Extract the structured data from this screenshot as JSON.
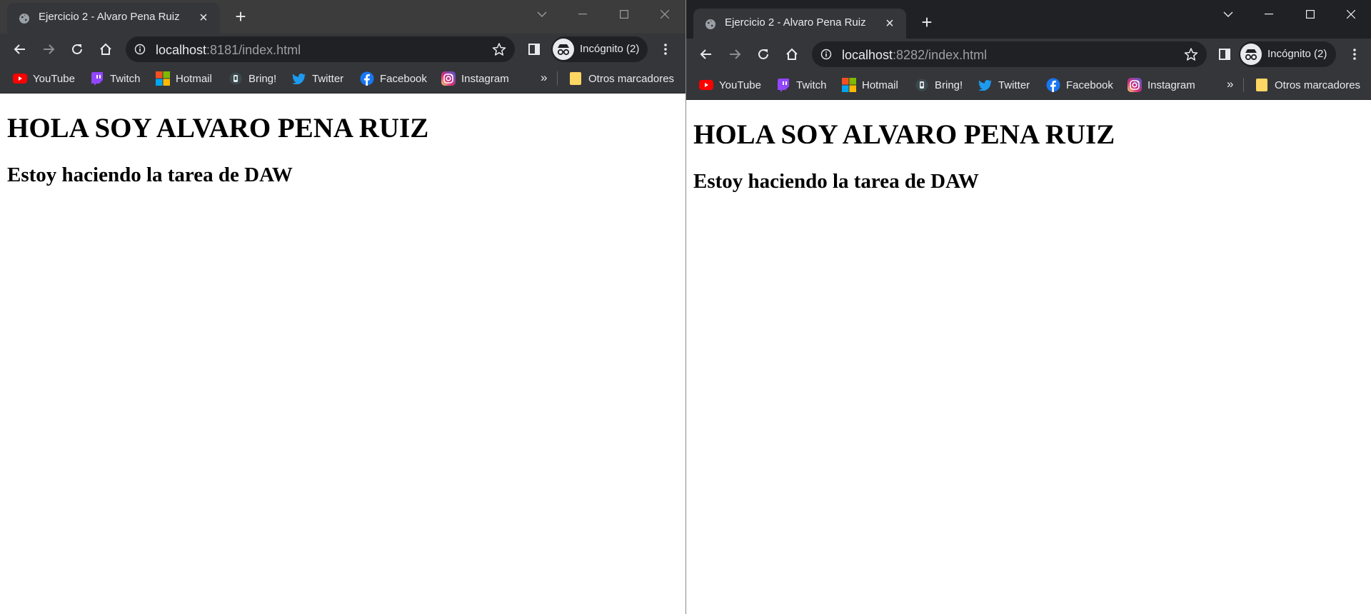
{
  "left_window": {
    "tab_title": "Ejercicio 2 - Alvaro Pena Ruiz",
    "url_host": "localhost",
    "url_rest": ":8181/index.html",
    "incognito_label": "Incógnito (2)",
    "heading": "HOLA SOY ALVARO PENA RUIZ",
    "subheading": "Estoy haciendo la tarea de DAW"
  },
  "right_window": {
    "tab_title": "Ejercicio 2 - Alvaro Pena Ruiz",
    "url_host": "localhost",
    "url_rest": ":8282/index.html",
    "incognito_label": "Incógnito (2)",
    "heading": "HOLA SOY ALVARO PENA RUIZ",
    "subheading": "Estoy haciendo la tarea de DAW"
  },
  "bookmarks": [
    {
      "label": "YouTube",
      "icon": "youtube-icon"
    },
    {
      "label": "Twitch",
      "icon": "twitch-icon"
    },
    {
      "label": "Hotmail",
      "icon": "microsoft-icon"
    },
    {
      "label": "Bring!",
      "icon": "bring-icon"
    },
    {
      "label": "Twitter",
      "icon": "twitter-icon"
    },
    {
      "label": "Facebook",
      "icon": "facebook-icon"
    },
    {
      "label": "Instagram",
      "icon": "instagram-icon"
    }
  ],
  "overflow_chevron": "»",
  "other_bookmarks": "Otros marcadores",
  "colors": {
    "titlebar": "#202124",
    "toolbar": "#35363a",
    "omnibox": "#202124",
    "text": "#e8eaed",
    "url_muted": "#9aa0a6"
  }
}
